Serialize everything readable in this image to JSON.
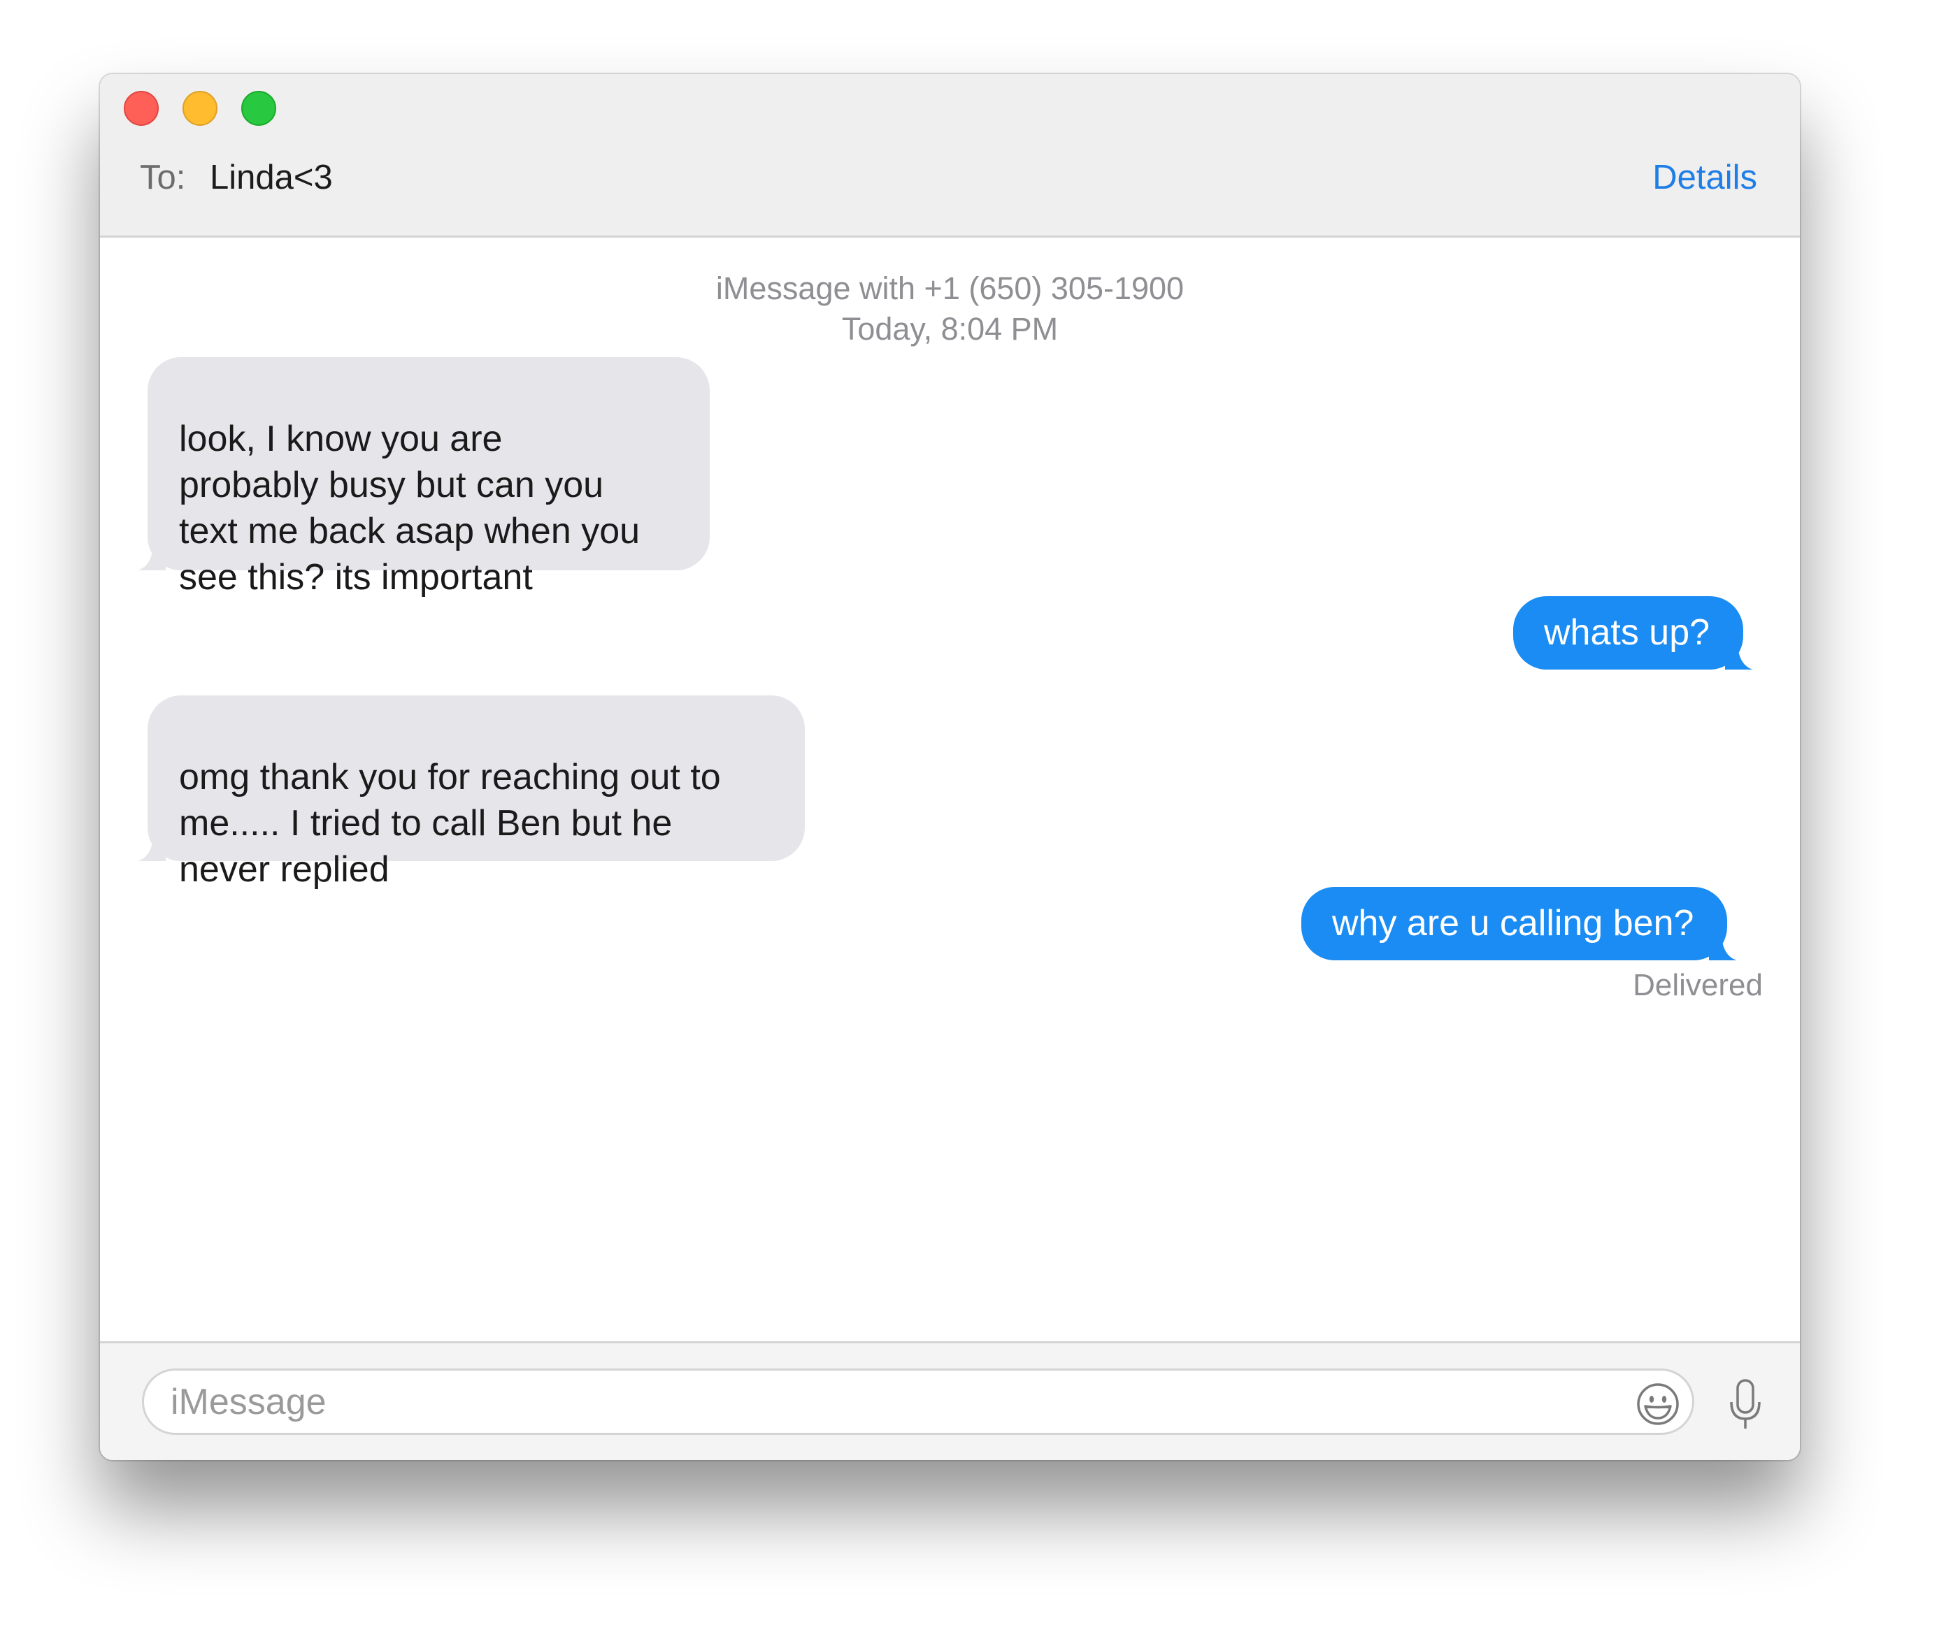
{
  "window": {
    "controls": [
      "close",
      "minimize",
      "zoom"
    ]
  },
  "header": {
    "to_label": "To:",
    "recipient": "Linda<3",
    "details_label": "Details"
  },
  "thread": {
    "service_line": "iMessage with +1 (650) 305-1900",
    "timestamp": "Today, 8:04 PM",
    "messages": [
      {
        "direction": "received",
        "text": "look, I know you are\nprobably busy but can you\ntext me back asap when you\nsee this? its important"
      },
      {
        "direction": "sent",
        "text": "whats up?"
      },
      {
        "direction": "received",
        "text": "omg thank you for reaching out to\nme..... I tried to call Ben but he\nnever replied"
      },
      {
        "direction": "sent",
        "text": "why are u calling ben?"
      }
    ],
    "status": "Delivered"
  },
  "composer": {
    "placeholder": "iMessage",
    "value": "",
    "emoji_icon": "smiley-face-icon",
    "mic_icon": "microphone-icon"
  },
  "colors": {
    "sent_bubble": "#1b8cf3",
    "received_bubble": "#e5e5ea",
    "accent": "#1f7de6",
    "close": "#fe5f57",
    "minimize": "#febc2e",
    "zoom": "#28c840"
  }
}
